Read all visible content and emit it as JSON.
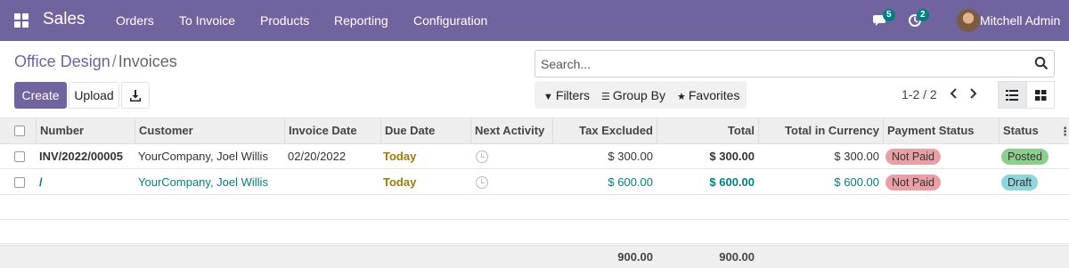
{
  "navbar": {
    "brand": "Sales",
    "menu": [
      "Orders",
      "To Invoice",
      "Products",
      "Reporting",
      "Configuration"
    ],
    "messages_badge": "5",
    "activities_badge": "2",
    "user": "Mitchell Admin",
    "bg_color": "#71639e"
  },
  "breadcrumb": {
    "parent": "Office Design",
    "separator": "/",
    "current": "Invoices"
  },
  "buttons": {
    "create": "Create",
    "upload": "Upload",
    "download_icon": "download-icon"
  },
  "search": {
    "placeholder": "Search..."
  },
  "filters": {
    "filters": "Filters",
    "group_by": "Group By",
    "favorites": "Favorites"
  },
  "pager": {
    "value": "1-2 / 2"
  },
  "table": {
    "columns": [
      "Number",
      "Customer",
      "Invoice Date",
      "Due Date",
      "Next Activity",
      "Tax Excluded",
      "Total",
      "Total in Currency",
      "Payment Status",
      "Status"
    ],
    "rows": [
      {
        "number": "INV/2022/00005",
        "customer": "YourCompany, Joel Willis",
        "invoice_date": "02/20/2022",
        "due_date": "Today",
        "tax_excluded": "$ 300.00",
        "total": "$ 300.00",
        "total_currency": "$ 300.00",
        "payment_status": "Not Paid",
        "status": "Posted"
      },
      {
        "number": "/",
        "customer": "YourCompany, Joel Willis",
        "invoice_date": "",
        "due_date": "Today",
        "tax_excluded": "$ 600.00",
        "total": "$ 600.00",
        "total_currency": "$ 600.00",
        "payment_status": "Not Paid",
        "status": "Draft"
      }
    ],
    "totals": {
      "tax_excluded": "900.00",
      "total": "900.00"
    }
  },
  "colors": {
    "accent": "#71639e",
    "teal": "#017e84",
    "today": "#a07a06",
    "not_paid": "#e8a0a6",
    "posted": "#8fce8f",
    "draft": "#90d5dc"
  }
}
